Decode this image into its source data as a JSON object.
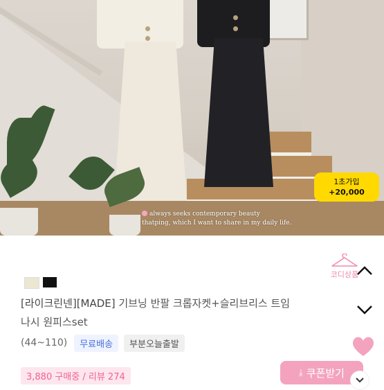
{
  "promo": {
    "line1": "1초가입",
    "line2": "+20,000"
  },
  "photo_caption": {
    "line1": "always seeks contemporary beauty",
    "line2": "thatping, which I want to share in my daily life."
  },
  "swatches": [
    "cream",
    "black"
  ],
  "codi_button": {
    "label": "코디상품"
  },
  "product": {
    "brand": "[라이크린넨][MADE]",
    "title_rest": " 기브닝 반팔 크롭자켓+슬리브리스 트임",
    "title_line2": "나시 원피스set",
    "size": "(44~110)",
    "tags": [
      "무료배송",
      "부분오늘출발"
    ]
  },
  "stats": "3,880 구매중 / 리뷰 274",
  "coupon_button": {
    "label": "쿠폰받기"
  },
  "colors": {
    "accent_pink": "#f4a3bf",
    "promo_yellow": "#ffd900",
    "ship_blue": "#4a6fd8"
  }
}
